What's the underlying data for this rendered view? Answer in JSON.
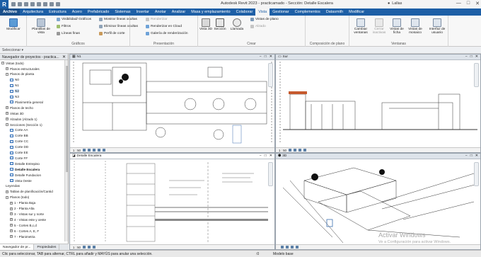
{
  "window": {
    "title": "Autodesk Revit 2023 - practicamado - Sección: Detalle Escalera",
    "user": "Lallas",
    "win_min": "—",
    "win_max": "□",
    "win_close": "✕"
  },
  "tabs": [
    "Archivo",
    "Arquitectura",
    "Estructura",
    "Acero",
    "Prefabricado",
    "Sistemas",
    "Insertar",
    "Anotar",
    "Analizar",
    "Masa y emplazamiento",
    "Colaborar",
    "Vista",
    "Gestionar",
    "Complementos",
    "Datasmith",
    "Modificar"
  ],
  "active_tab": "Vista",
  "ribbon": {
    "modify": "Modificar",
    "templates": "Plantillas de vista",
    "visibility": "Visibilidad/ Gráficos",
    "filters": "Filtros",
    "thin_lines": "Líneas finas",
    "show_hidden": "Mostrar líneas ocultas",
    "remove_hidden": "Eliminar líneas ocultas",
    "cut_profile": "Perfil de corte",
    "render": "Renderizar",
    "render_cloud": "Renderizar en Cloud",
    "render_gallery": "Galería de renderización",
    "view3d": "Vista 3D",
    "section": "Sección",
    "callout": "Llamada",
    "plan_views": "Vistas de plano",
    "elevation": "Alzado",
    "switch_windows": "Cambiar ventanas",
    "close_inactive": "Cerrar inactivas",
    "tab_views": "Vistas de ficha",
    "tile_views": "Vistas de mosaico",
    "user_interface": "Interfaz de usuario",
    "panels": [
      "Gráficos",
      "Presentación",
      "Crear",
      "Composición de plano",
      "Ventanas"
    ]
  },
  "options_bar": {
    "select": "Seleccionar ▾"
  },
  "browser": {
    "title": "Navegador de proyectos - practica...",
    "close": "✕",
    "items": [
      {
        "label": "Vistas (todo)",
        "tw": "−",
        "icon": false
      },
      {
        "label": "Planos estructurales",
        "tw": "+",
        "icon": false
      },
      {
        "label": "Planos de planta",
        "tw": "−",
        "icon": false
      },
      {
        "label": "N0",
        "tw": "",
        "icon": true
      },
      {
        "label": "N1",
        "tw": "",
        "icon": true
      },
      {
        "label": "N2",
        "tw": "",
        "icon": true
      },
      {
        "label": "N3",
        "tw": "",
        "icon": true
      },
      {
        "label": "Planimetría general",
        "tw": "",
        "icon": true
      },
      {
        "label": "Planos de techo",
        "tw": "+",
        "icon": false
      },
      {
        "label": "Vistas 3D",
        "tw": "+",
        "icon": false
      },
      {
        "label": "Alzados (Alzado 1)",
        "tw": "+",
        "icon": false
      },
      {
        "label": "Secciones (Sección 1)",
        "tw": "−",
        "icon": false
      },
      {
        "label": "Corte AA",
        "tw": "",
        "icon": true
      },
      {
        "label": "Corte BB",
        "tw": "",
        "icon": true
      },
      {
        "label": "Corte CC",
        "tw": "",
        "icon": true
      },
      {
        "label": "Corte DD",
        "tw": "",
        "icon": true
      },
      {
        "label": "Corte EE",
        "tw": "",
        "icon": true
      },
      {
        "label": "Corte FF",
        "tw": "",
        "icon": true
      },
      {
        "label": "Detalle Entrepiso",
        "tw": "",
        "icon": true
      },
      {
        "label": "Detalle Escalera",
        "tw": "",
        "icon": true
      },
      {
        "label": "Detalle Fundacion",
        "tw": "",
        "icon": true
      },
      {
        "label": "Vista Oeste",
        "tw": "",
        "icon": true
      },
      {
        "label": "Leyendas",
        "tw": "",
        "icon": false
      },
      {
        "label": "Tablas de planificación/Cantid",
        "tw": "+",
        "icon": false
      },
      {
        "label": "Planos (todo)",
        "tw": "−",
        "icon": false
      },
      {
        "label": "1 - Planta Baja",
        "tw": "+",
        "icon": false
      },
      {
        "label": "2 - Planta Alta",
        "tw": "+",
        "icon": false
      },
      {
        "label": "3 - Vistas sur y norte",
        "tw": "+",
        "icon": false
      },
      {
        "label": "4 - Vistas este y oeste",
        "tw": "+",
        "icon": false
      },
      {
        "label": "5 - Cortes B,c,d",
        "tw": "+",
        "icon": false
      },
      {
        "label": "6 - Cortes A, E, F",
        "tw": "+",
        "icon": false
      },
      {
        "label": "7 - Planimetria",
        "tw": "+",
        "icon": false
      }
    ],
    "tab_nav": "Navegador de pr...",
    "tab_props": "Propiedades"
  },
  "views": {
    "tl": {
      "title": "N1",
      "scale": "1 : 50"
    },
    "tr": {
      "title": "Sur",
      "scale": "1 : 50"
    },
    "bl": {
      "title": "Detalle Escalera",
      "scale": "1 : 50"
    },
    "br": {
      "title": "3D",
      "scale": ""
    }
  },
  "status": {
    "hint": "Clic para seleccionar, TAB para alternar, CTRL para añadir y MAYÚS para anular una selección.",
    "model": "Modelo base",
    "zero": ":0"
  },
  "watermark": {
    "line1": "Activar Windows",
    "line2": "Ve a Configuración para activar Windows."
  },
  "colors": {
    "accent": "#1d5fa6",
    "selection": "#cde3f8"
  }
}
